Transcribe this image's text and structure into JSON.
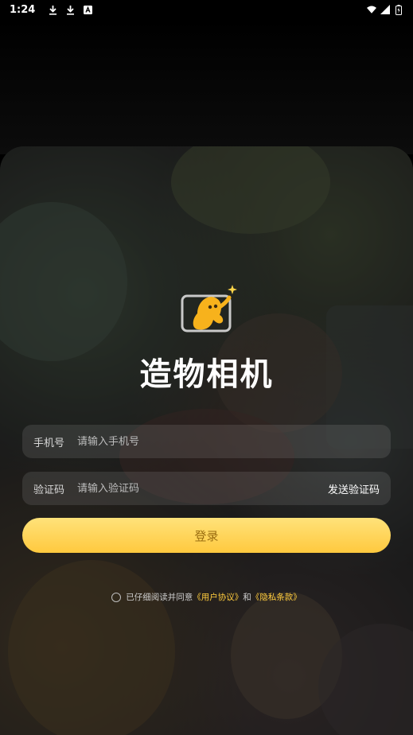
{
  "status_bar": {
    "time": "1:24",
    "left_icons": [
      "download-icon",
      "download-icon",
      "app-notification-icon"
    ],
    "right_icons": [
      "wifi-icon",
      "signal-icon",
      "battery-icon"
    ]
  },
  "app": {
    "title": "造物相机",
    "logo_icon": "mascot-camera-logo",
    "accent_color": "#ffc93e"
  },
  "form": {
    "phone": {
      "label": "手机号",
      "placeholder": "请输入手机号",
      "value": ""
    },
    "code": {
      "label": "验证码",
      "placeholder": "请输入验证码",
      "value": "",
      "send_label": "发送验证码"
    },
    "login_label": "登录"
  },
  "agreement": {
    "checked": false,
    "prefix": "已仔细阅读并同意",
    "user_agreement": "《用户协议》",
    "joiner": "和",
    "privacy_policy": "《隐私条款》"
  }
}
